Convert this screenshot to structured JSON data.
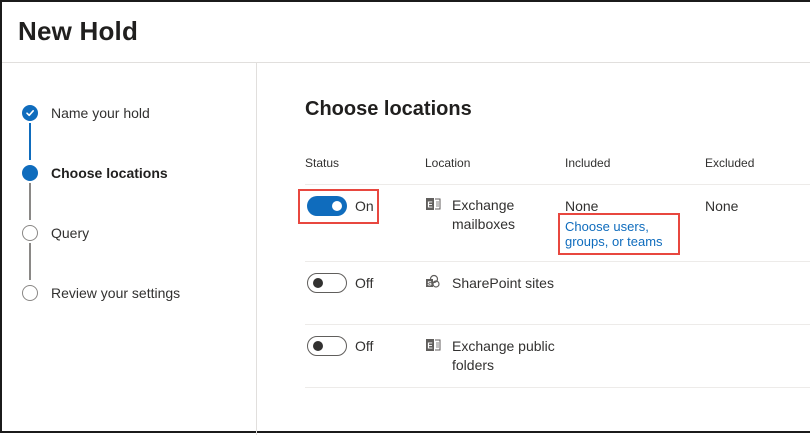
{
  "header": {
    "title": "New Hold"
  },
  "steps": [
    {
      "label": "Name your hold",
      "state": "done"
    },
    {
      "label": "Choose locations",
      "state": "current"
    },
    {
      "label": "Query",
      "state": "todo"
    },
    {
      "label": "Review your settings",
      "state": "todo"
    }
  ],
  "main": {
    "heading": "Choose locations",
    "columns": {
      "status": "Status",
      "location": "Location",
      "included": "Included",
      "excluded": "Excluded"
    },
    "rows": [
      {
        "status": "On",
        "enabled": true,
        "location_line1": "Exchange",
        "location_line2": "mailboxes",
        "icon": "exchange-icon",
        "included": "None",
        "included_link_line1": "Choose users,",
        "included_link_line2": "groups, or teams",
        "excluded": "None"
      },
      {
        "status": "Off",
        "enabled": false,
        "location_line1": "SharePoint sites",
        "icon": "sharepoint-icon"
      },
      {
        "status": "Off",
        "enabled": false,
        "location_line1": "Exchange public",
        "location_line2": "folders",
        "icon": "exchange-icon"
      }
    ]
  },
  "colors": {
    "accent": "#0f6cbd",
    "highlight": "#e8473f"
  }
}
